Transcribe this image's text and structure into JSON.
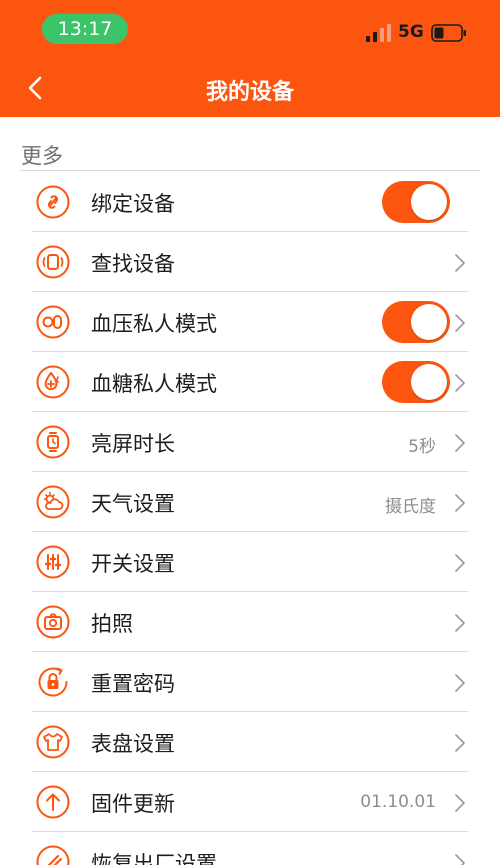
{
  "status_bar": {
    "time": "13:17",
    "network": "5G"
  },
  "nav": {
    "title": "我的设备"
  },
  "section": {
    "label": "更多"
  },
  "rows": [
    {
      "label": "绑定设备",
      "icon": "link-icon"
    },
    {
      "label": "查找设备",
      "icon": "watch-vibrate-icon"
    },
    {
      "label": "血压私人模式",
      "icon": "blood-pressure-icon"
    },
    {
      "label": "血糖私人模式",
      "icon": "blood-drop-plus-icon"
    },
    {
      "label": "亮屏时长",
      "value": "5秒",
      "icon": "watch-screen-icon"
    },
    {
      "label": "天气设置",
      "value": "摄氏度",
      "icon": "weather-icon"
    },
    {
      "label": "开关设置",
      "icon": "sliders-icon"
    },
    {
      "label": "拍照",
      "icon": "camera-icon"
    },
    {
      "label": "重置密码",
      "icon": "reset-lock-icon"
    },
    {
      "label": "表盘设置",
      "icon": "watch-face-shirt-icon"
    },
    {
      "label": "固件更新",
      "value": "01.10.01",
      "icon": "upload-arrow-icon"
    },
    {
      "label": "恢复出厂设置",
      "icon": "factory-reset-icon"
    }
  ],
  "toggles": {
    "bind_device": true,
    "bp_private": true,
    "bg_private": true
  },
  "colors": {
    "accent": "#fc5510",
    "status_time_bg": "#3bc46a"
  }
}
